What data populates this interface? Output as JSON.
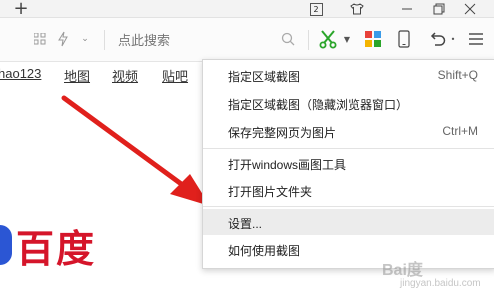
{
  "titlebar": {
    "new_tab": "+",
    "tab_count": "2"
  },
  "toolbar": {
    "search_placeholder": "点此搜索"
  },
  "navbar": {
    "links": [
      "hao123",
      "地图",
      "视频",
      "贴吧"
    ]
  },
  "context_menu": {
    "items": [
      {
        "label": "指定区域截图",
        "shortcut": "Shift+Q"
      },
      {
        "label": "指定区域截图（隐藏浏览器窗口）",
        "shortcut": ""
      },
      {
        "label": "保存完整网页为图片",
        "shortcut": "Ctrl+M"
      },
      {
        "label": "打开windows画图工具",
        "shortcut": ""
      },
      {
        "label": "打开图片文件夹",
        "shortcut": ""
      },
      {
        "label": "设置...",
        "shortcut": ""
      },
      {
        "label": "如何使用截图",
        "shortcut": ""
      }
    ]
  },
  "page": {
    "logo_text": "百度",
    "watermark": "Bai度",
    "watermark_sub": "jingyan.baidu.com"
  },
  "colors": {
    "accent_green": "#2aa52a",
    "arrow_red": "#e0201c",
    "baidu_red": "#d5152a",
    "baidu_blue": "#2b56d4"
  }
}
